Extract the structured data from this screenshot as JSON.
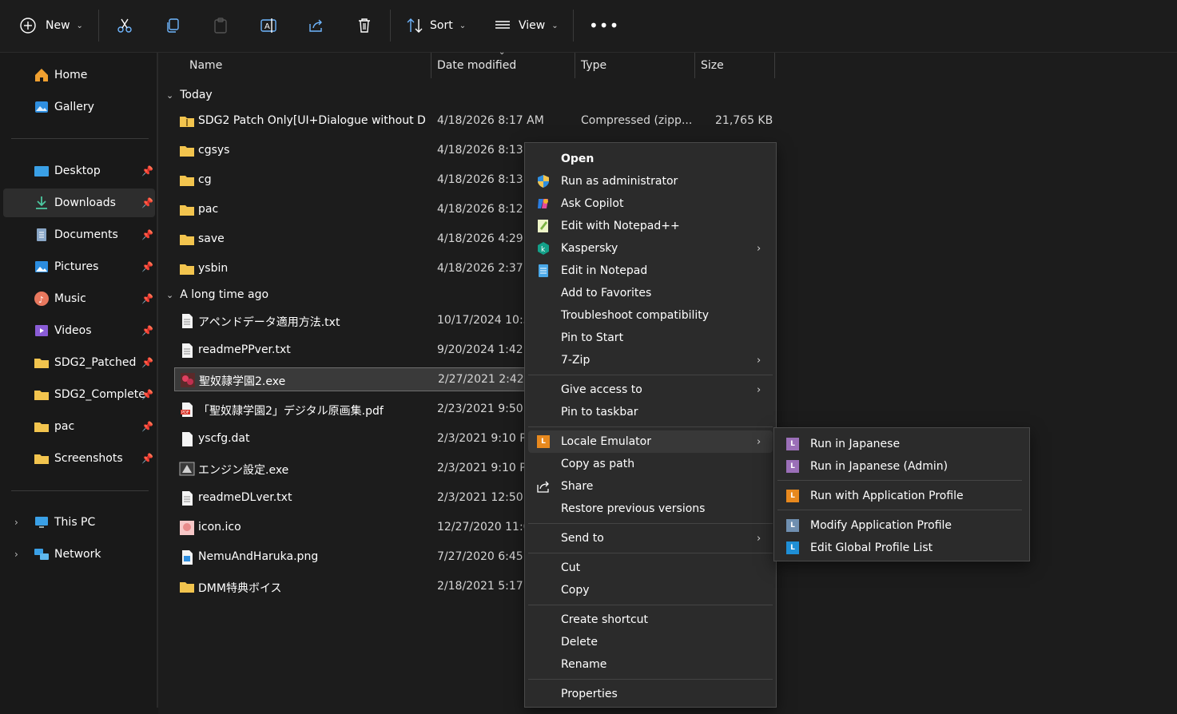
{
  "toolbar": {
    "new_label": "New",
    "sort_label": "Sort",
    "view_label": "View"
  },
  "nav": {
    "items": [
      {
        "label": "Home"
      },
      {
        "label": "Gallery"
      },
      {
        "label": "Desktop"
      },
      {
        "label": "Downloads"
      },
      {
        "label": "Documents"
      },
      {
        "label": "Pictures"
      },
      {
        "label": "Music"
      },
      {
        "label": "Videos"
      },
      {
        "label": "SDG2_Patched"
      },
      {
        "label": "SDG2_Complete"
      },
      {
        "label": "pac"
      },
      {
        "label": "Screenshots"
      },
      {
        "label": "This PC"
      },
      {
        "label": "Network"
      }
    ]
  },
  "columns": {
    "name": "Name",
    "date": "Date modified",
    "type": "Type",
    "size": "Size"
  },
  "groups": {
    "today": "Today",
    "longago": "A long time ago"
  },
  "files": [
    {
      "name": "SDG2 Patch Only[UI+Dialogue without D...",
      "date": "4/18/2026 8:17 AM",
      "type": "Compressed (zipp...",
      "size": "21,765 KB"
    },
    {
      "name": "cgsys",
      "date": "4/18/2026 8:13 AM"
    },
    {
      "name": "cg",
      "date": "4/18/2026 8:13 AM"
    },
    {
      "name": "pac",
      "date": "4/18/2026 8:12 AM"
    },
    {
      "name": "save",
      "date": "4/18/2026 4:29 AM"
    },
    {
      "name": "ysbin",
      "date": "4/18/2026 2:37 AM"
    },
    {
      "name": "アペンドデータ適用方法.txt",
      "date": "10/17/2024 10:30"
    },
    {
      "name": "readmePPver.txt",
      "date": "9/20/2024 1:42 AM"
    },
    {
      "name": "聖奴隷学園2.exe",
      "date": "2/27/2021 2:42 AM"
    },
    {
      "name": "「聖奴隷学園2」デジタル原画集.pdf",
      "date": "2/23/2021 9:50 PM"
    },
    {
      "name": "yscfg.dat",
      "date": "2/3/2021 9:10 PM"
    },
    {
      "name": "エンジン設定.exe",
      "date": "2/3/2021 9:10 PM"
    },
    {
      "name": "readmeDLver.txt",
      "date": "2/3/2021 12:50 AM"
    },
    {
      "name": "icon.ico",
      "date": "12/27/2020 11:02"
    },
    {
      "name": "NemuAndHaruka.png",
      "date": "7/27/2020 6:45 PM"
    },
    {
      "name": "DMM特典ボイス",
      "date": "2/18/2021 5:17 PM"
    }
  ],
  "context_menu": {
    "items": [
      {
        "label": "Open"
      },
      {
        "label": "Run as administrator"
      },
      {
        "label": "Ask Copilot"
      },
      {
        "label": "Edit with Notepad++"
      },
      {
        "label": "Kaspersky"
      },
      {
        "label": "Edit in Notepad"
      },
      {
        "label": "Add to Favorites"
      },
      {
        "label": "Troubleshoot compatibility"
      },
      {
        "label": "Pin to Start"
      },
      {
        "label": "7-Zip"
      },
      {
        "label": "Give access to"
      },
      {
        "label": "Pin to taskbar"
      },
      {
        "label": "Locale Emulator"
      },
      {
        "label": "Copy as path"
      },
      {
        "label": "Share"
      },
      {
        "label": "Restore previous versions"
      },
      {
        "label": "Send to"
      },
      {
        "label": "Cut"
      },
      {
        "label": "Copy"
      },
      {
        "label": "Create shortcut"
      },
      {
        "label": "Delete"
      },
      {
        "label": "Rename"
      },
      {
        "label": "Properties"
      }
    ]
  },
  "submenu": {
    "items": [
      {
        "label": "Run in Japanese",
        "color": "#9b6fb8"
      },
      {
        "label": "Run in Japanese (Admin)",
        "color": "#9b6fb8"
      },
      {
        "label": "Run with Application Profile",
        "color": "#e8891e"
      },
      {
        "label": "Modify Application Profile",
        "color": "#6f8fb0"
      },
      {
        "label": "Edit Global Profile List",
        "color": "#1f8fd6"
      }
    ]
  },
  "colors": {
    "folder": "#f2c44e",
    "accent": "#4cc2ff"
  }
}
